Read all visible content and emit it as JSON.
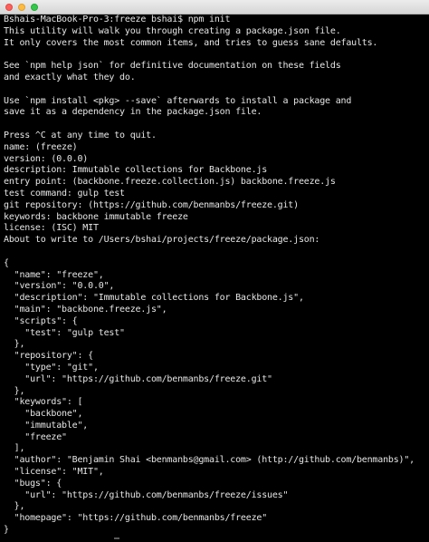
{
  "window": {
    "title": ""
  },
  "terminal": {
    "lines": [
      "Bshais-MacBook-Pro-3:freeze bshai$ npm init",
      "This utility will walk you through creating a package.json file.",
      "It only covers the most common items, and tries to guess sane defaults.",
      "",
      "See `npm help json` for definitive documentation on these fields",
      "and exactly what they do.",
      "",
      "Use `npm install <pkg> --save` afterwards to install a package and",
      "save it as a dependency in the package.json file.",
      "",
      "Press ^C at any time to quit.",
      "name: (freeze)",
      "version: (0.0.0)",
      "description: Immutable collections for Backbone.js",
      "entry point: (backbone.freeze.collection.js) backbone.freeze.js",
      "test command: gulp test",
      "git repository: (https://github.com/benmanbs/freeze.git)",
      "keywords: backbone immutable freeze",
      "license: (ISC) MIT",
      "About to write to /Users/bshai/projects/freeze/package.json:",
      "",
      "{",
      "  \"name\": \"freeze\",",
      "  \"version\": \"0.0.0\",",
      "  \"description\": \"Immutable collections for Backbone.js\",",
      "  \"main\": \"backbone.freeze.js\",",
      "  \"scripts\": {",
      "    \"test\": \"gulp test\"",
      "  },",
      "  \"repository\": {",
      "    \"type\": \"git\",",
      "    \"url\": \"https://github.com/benmanbs/freeze.git\"",
      "  },",
      "  \"keywords\": [",
      "    \"backbone\",",
      "    \"immutable\",",
      "    \"freeze\"",
      "  ],",
      "  \"author\": \"Benjamin Shai <benmanbs@gmail.com> (http://github.com/benmanbs)\",",
      "  \"license\": \"MIT\",",
      "  \"bugs\": {",
      "    \"url\": \"https://github.com/benmanbs/freeze/issues\"",
      "  },",
      "  \"homepage\": \"https://github.com/benmanbs/freeze\"",
      "}"
    ]
  },
  "colors": {
    "background": "#000000",
    "text": "#e6e6e6"
  }
}
